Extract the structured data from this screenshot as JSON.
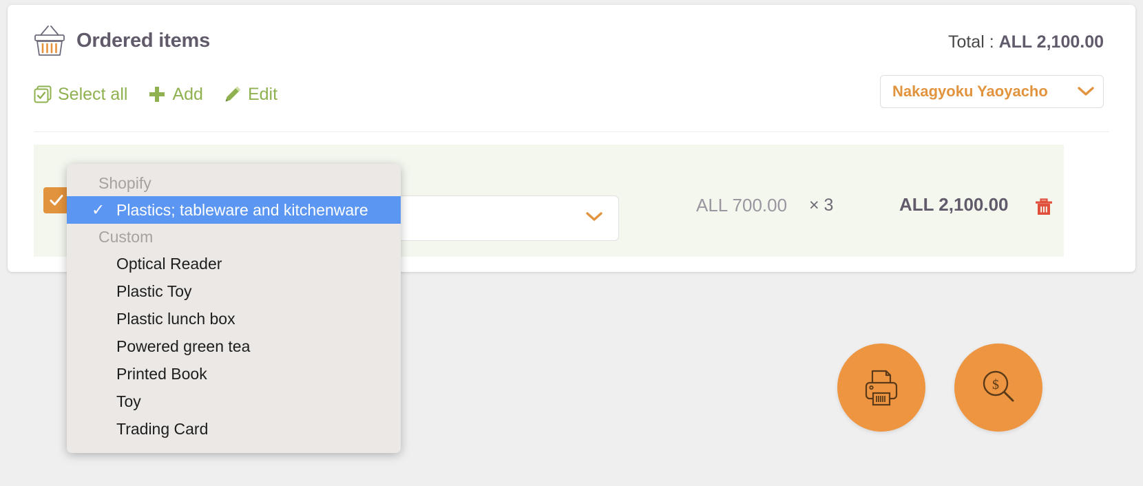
{
  "header": {
    "basket_icon": "shopping-basket-icon",
    "title": "Ordered items",
    "total_label": "Total : ",
    "total_value": "ALL 2,100.00"
  },
  "toolbar": {
    "select_all_label": "Select all",
    "select_all_icon": "checkbox-stack-icon",
    "add_label": "Add",
    "add_icon": "plus-icon",
    "edit_label": "Edit",
    "edit_icon": "pencil-icon"
  },
  "store_selector": {
    "value": "Nakagyoku Yaoyacho",
    "chevron_icon": "chevron-down-icon"
  },
  "item_row": {
    "checked": true,
    "check_icon": "check-icon",
    "title": "",
    "category_value": "Plastics; tableware and kitchenware",
    "category_chevron_icon": "chevron-down-icon",
    "unit_price": "ALL 700.00",
    "quantity": "× 3",
    "line_total": "ALL 2,100.00",
    "delete_icon": "trash-icon"
  },
  "dropdown": {
    "groups": [
      {
        "label": "Shopify",
        "items": [
          {
            "label": "Plastics; tableware and kitchenware",
            "selected": true,
            "check_icon": "check-icon"
          }
        ]
      },
      {
        "label": "Custom",
        "items": [
          {
            "label": "Optical Reader",
            "selected": false
          },
          {
            "label": "Plastic Toy",
            "selected": false
          },
          {
            "label": "Plastic lunch box",
            "selected": false
          },
          {
            "label": "Powered green tea",
            "selected": false
          },
          {
            "label": "Printed Book",
            "selected": false
          },
          {
            "label": "Toy",
            "selected": false
          },
          {
            "label": "Trading Card",
            "selected": false
          }
        ]
      }
    ]
  },
  "fabs": [
    {
      "name": "print-button",
      "icon": "printer-icon"
    },
    {
      "name": "price-search-button",
      "icon": "magnifier-dollar-icon"
    }
  ],
  "colors": {
    "accent_orange": "#e2933d",
    "fab_orange": "#ed9540",
    "green": "#8fb14f",
    "purple_text": "#615a6b",
    "row_bg": "#f3f7ee",
    "selected_blue": "#5b96f2",
    "delete_red": "#e0503c",
    "menu_bg": "#ece8e5"
  }
}
